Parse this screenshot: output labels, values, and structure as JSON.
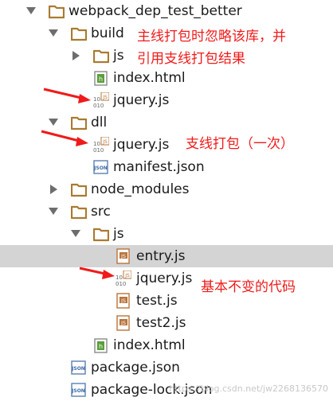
{
  "tree": {
    "root": "webpack_dep_test_better",
    "build": {
      "label": "build",
      "js": "js",
      "index_html": "index.html",
      "jquery": "jquery.js"
    },
    "dll": {
      "label": "dll",
      "jquery": "jquery.js",
      "manifest": "manifest.json"
    },
    "node_modules": "node_modules",
    "src": {
      "label": "src",
      "js": "js",
      "entry": "entry.js",
      "jquery": "jquery.js",
      "test": "test.js",
      "test2": "test2.js",
      "index_html": "index.html"
    },
    "package_json": "package.json",
    "package_lock": "package-lock.json"
  },
  "annotations": {
    "build_note_line1": "主线打包时忽略该库，并",
    "build_note_line2": "引用支线打包结果",
    "dll_note": "支线打包（一次）",
    "src_note": "基本不变的代码"
  },
  "watermark": "https://blog.csdn.net/jw2268136570",
  "colors": {
    "folder": "#a97a30",
    "annotation": "#f01a1a",
    "selection": "#d4d4d4"
  }
}
